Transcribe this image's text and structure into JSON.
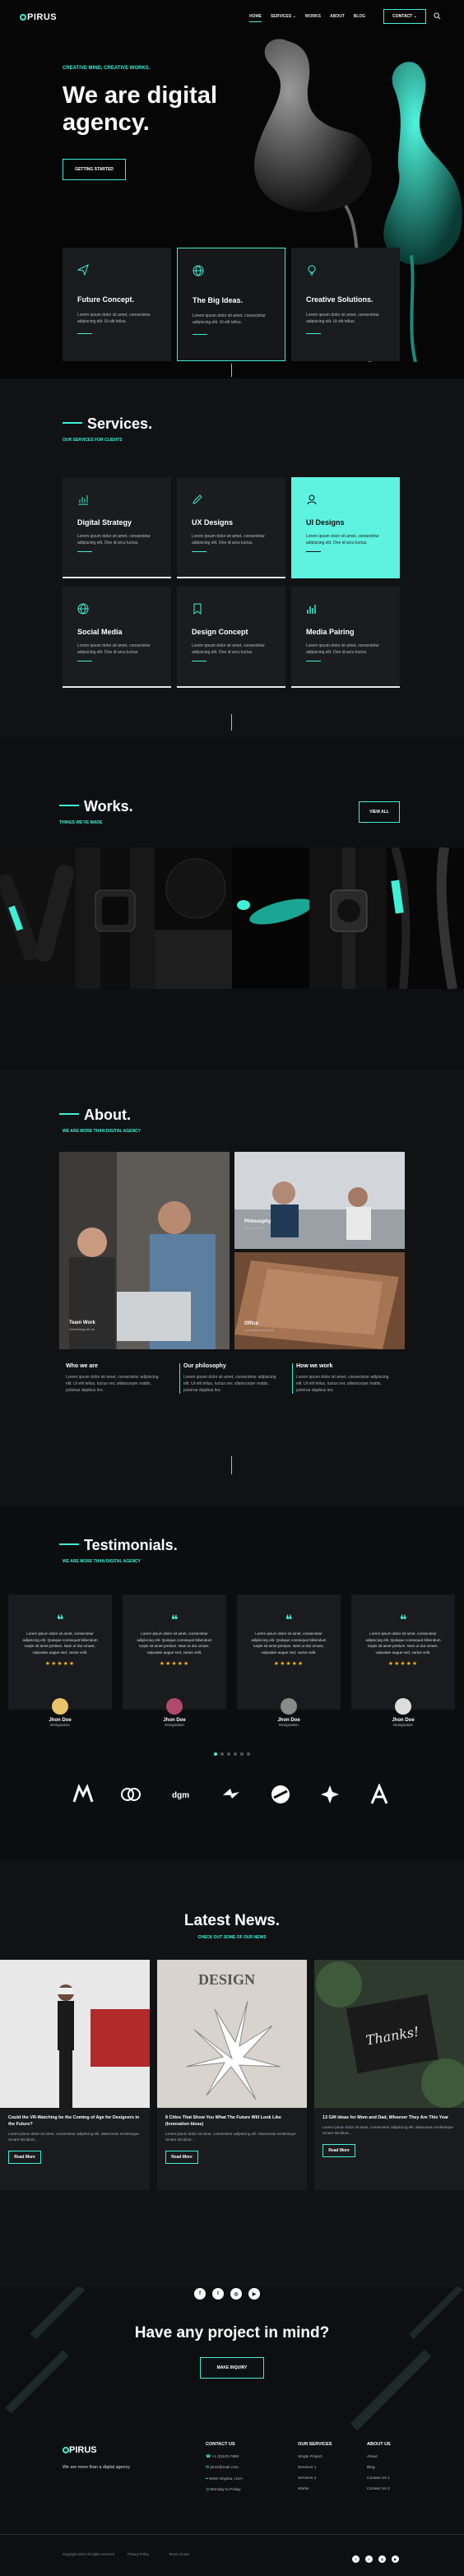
{
  "header": {
    "logo": "PIRUS",
    "nav": [
      "HOME",
      "SERVICES",
      "WORKS",
      "ABOUT",
      "BLOG"
    ],
    "contact_btn": "CONTACT"
  },
  "hero": {
    "subtitle": "CREATIVE MIND, CREATIVE WORKS.",
    "title": "We are digital agency.",
    "button": "GETTING STARTED",
    "features": [
      {
        "title": "Future Concept.",
        "text": "Lorem ipsum dolor sit amet, consectetur adipiscing elit. Ut elit tellus."
      },
      {
        "title": "The Big Ideas.",
        "text": "Lorem ipsum dolor sit amet, consectetur adipiscing elit. Ut elit tellus."
      },
      {
        "title": "Creative Solutions.",
        "text": "Lorem ipsum dolor sit amet, consectetur adipiscing elit. Ut elit tellus."
      }
    ]
  },
  "services": {
    "title": "Services.",
    "subtitle": "OUR SERVICES FOR CLIENTS",
    "items": [
      {
        "title": "Digital Strategy",
        "text": "Lorem ipsum dolor sit amet, consectetur adipiscing elit. One id arcu luctus."
      },
      {
        "title": "UX Designs",
        "text": "Lorem ipsum dolor sit amet, consectetur adipiscing elit. One id arcu luctus."
      },
      {
        "title": "UI Designs",
        "text": "Lorem ipsum dolor sit amet, consectetur adipiscing elit. One id arcu luctus."
      },
      {
        "title": "Social Media",
        "text": "Lorem ipsum dolor sit amet, consectetur adipiscing elit. One id arcu luctus."
      },
      {
        "title": "Design Concept",
        "text": "Lorem ipsum dolor sit amet, consectetur adipiscing elit. One id arcu luctus."
      },
      {
        "title": "Media Pairing",
        "text": "Lorem ipsum dolor sit amet, consectetur adipiscing elit. One id arcu luctus."
      }
    ]
  },
  "works": {
    "title": "Works.",
    "subtitle": "THINGS WE'VE MADE",
    "button": "VIEW ALL"
  },
  "about": {
    "title": "About.",
    "subtitle": "WE ARE MORE THAN DIGITAL AGENCY",
    "cards": [
      {
        "title": "Team Work",
        "sub": "Something we do"
      },
      {
        "title": "Philosophy",
        "sub": "Our ways of..."
      },
      {
        "title": "Office",
        "sub": "Sometimes we work"
      }
    ],
    "cols": [
      {
        "title": "Who we are",
        "text": "Lorem ipsum dolor sit amet, consectetur adipiscing elit. Ut elit tellus, luctus nec ullamcorper mattis, pulvinar dapibus leo."
      },
      {
        "title": "Our philosophy",
        "text": "Lorem ipsum dolor sit amet, consectetur adipiscing elit. Ut elit tellus, luctus nec ullamcorper mattis, pulvinar dapibus leo."
      },
      {
        "title": "How we work",
        "text": "Lorem ipsum dolor sit amet, consectetur adipiscing elit. Ut elit tellus, luctus nec ullamcorper mattis, pulvinar dapibus leo."
      }
    ]
  },
  "testimonials": {
    "title": "Testimonials.",
    "subtitle": "WE ARE MORE THAN DIGITAL AGENCY",
    "quote": "Lorem ipsum dolor sit amet, consectetur adipiscing elit. Quisque consequat bibendum turpis sit amet pretium. Nam ut dui ornare, vulputate augue sed, varius velit.",
    "stars": "★★★★★",
    "people": [
      {
        "name": "Jhon Doe",
        "role": "Designation"
      },
      {
        "name": "Jhon Doe",
        "role": "Designation"
      },
      {
        "name": "Jhon Doe",
        "role": "Designation"
      },
      {
        "name": "Jhon Doe",
        "role": "Designation"
      }
    ]
  },
  "news": {
    "title": "Latest News.",
    "subtitle": "CHECK OUT SOME OF OUR NEWS",
    "excerpt": "Lorem ipsum dolor sit amet, consectetur adipiscing elit. Maecenas scelerisque ornare tincidunt...",
    "read_more": "Read More",
    "items": [
      {
        "title": "Could the VR-Watching be the Coming of Age for Designers in the Future?"
      },
      {
        "title": "8 Cities That Show You What The Future Will Look Like (Innovation Ideas)"
      },
      {
        "title": "13 Gift Ideas for Mom and Dad, Whoever They Are This Year"
      }
    ]
  },
  "cta": {
    "title": "Have any project in mind?",
    "button": "MAKE INQUIRY"
  },
  "footer": {
    "logo": "PIRUS",
    "tagline": "We are more than a digital agency",
    "contact_title": "CONTACT US",
    "contact": [
      "+1 (0)123-7890",
      "pirus@mail.com",
      "West Virginia, USA",
      "Monday to Friday"
    ],
    "services_title": "OUR SERVICES",
    "services": [
      "Single Project",
      "Services 1",
      "Services 2",
      "Works"
    ],
    "about_title": "ABOUT US",
    "about": [
      "About",
      "Blog",
      "Contact Us 1",
      "Contact Us 2"
    ],
    "copyright": "Copyright 2021 All rights reserved",
    "privacy": "Privacy Policy",
    "terms": "Terms of Use"
  }
}
